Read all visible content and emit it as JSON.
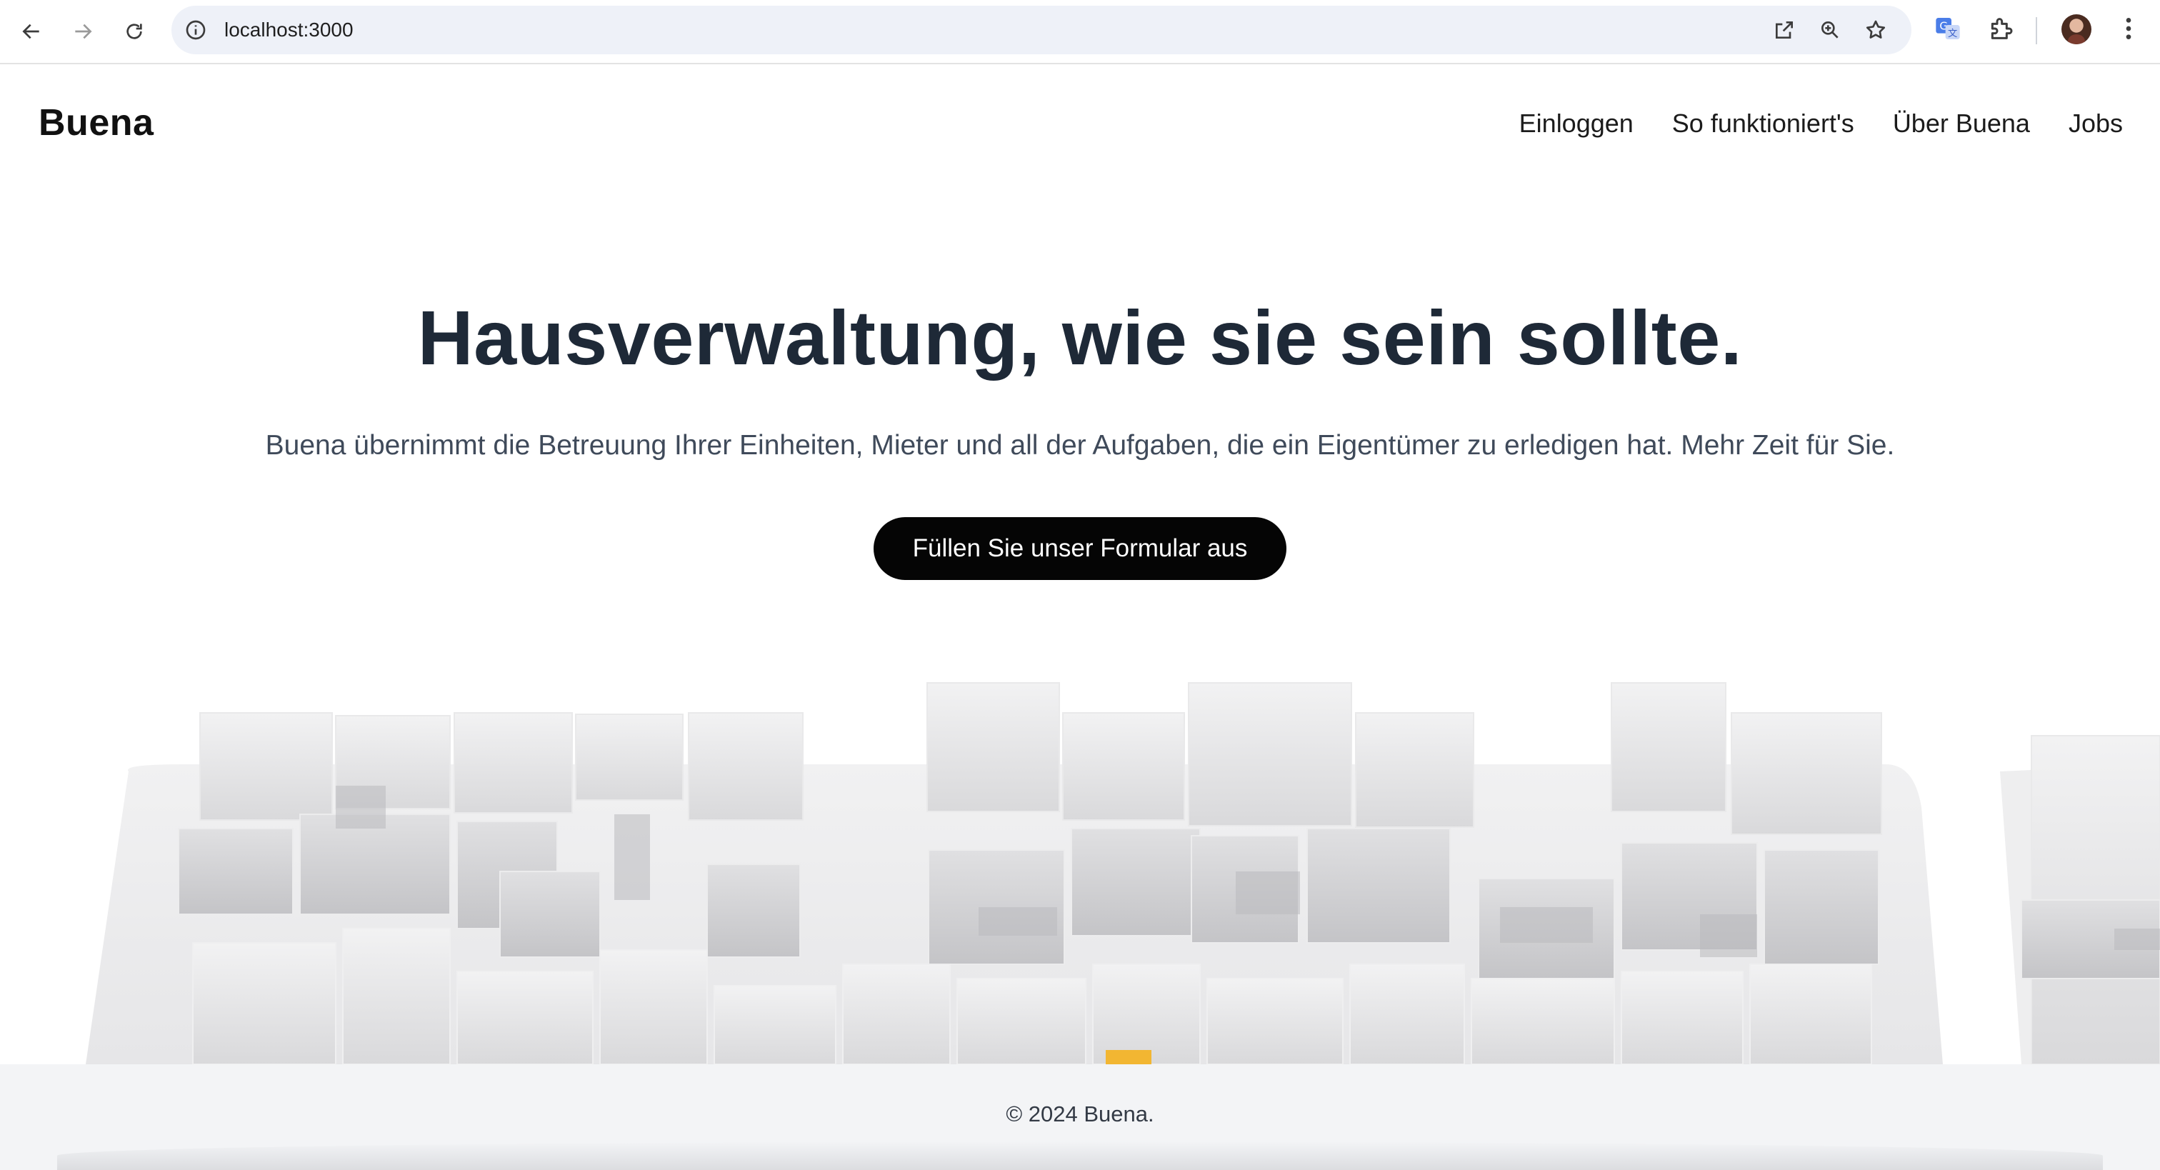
{
  "browser": {
    "url": "localhost:3000",
    "icons": [
      "back-arrow-icon",
      "forward-arrow-icon",
      "reload-icon",
      "site-info-icon",
      "open-external-icon",
      "zoom-icon",
      "bookmark-star-icon",
      "translate-icon",
      "extensions-puzzle-icon",
      "profile-avatar",
      "more-menu-icon"
    ]
  },
  "header": {
    "logo": "Buena",
    "nav": [
      "Einloggen",
      "So funktioniert's",
      "Über Buena",
      "Jobs"
    ]
  },
  "hero": {
    "title": "Hausverwaltung, wie sie sein sollte.",
    "subtitle": "Buena übernimmt die Betreuung Ihrer Einheiten, Mieter und all der Aufgaben, die ein Eigentümer zu erledigen hat. Mehr Zeit für Sie.",
    "cta": "Füllen Sie unser Formular aus"
  },
  "illustration": {
    "subject": "city-blocks-3d",
    "accent_color": "#f2b632"
  },
  "footer": {
    "copyright": "© 2024 Buena."
  },
  "colors": {
    "title": "#1e2937",
    "subtitle": "#3f4a5a",
    "cta_bg": "#050505",
    "footer_bg": "#f3f4f6"
  }
}
